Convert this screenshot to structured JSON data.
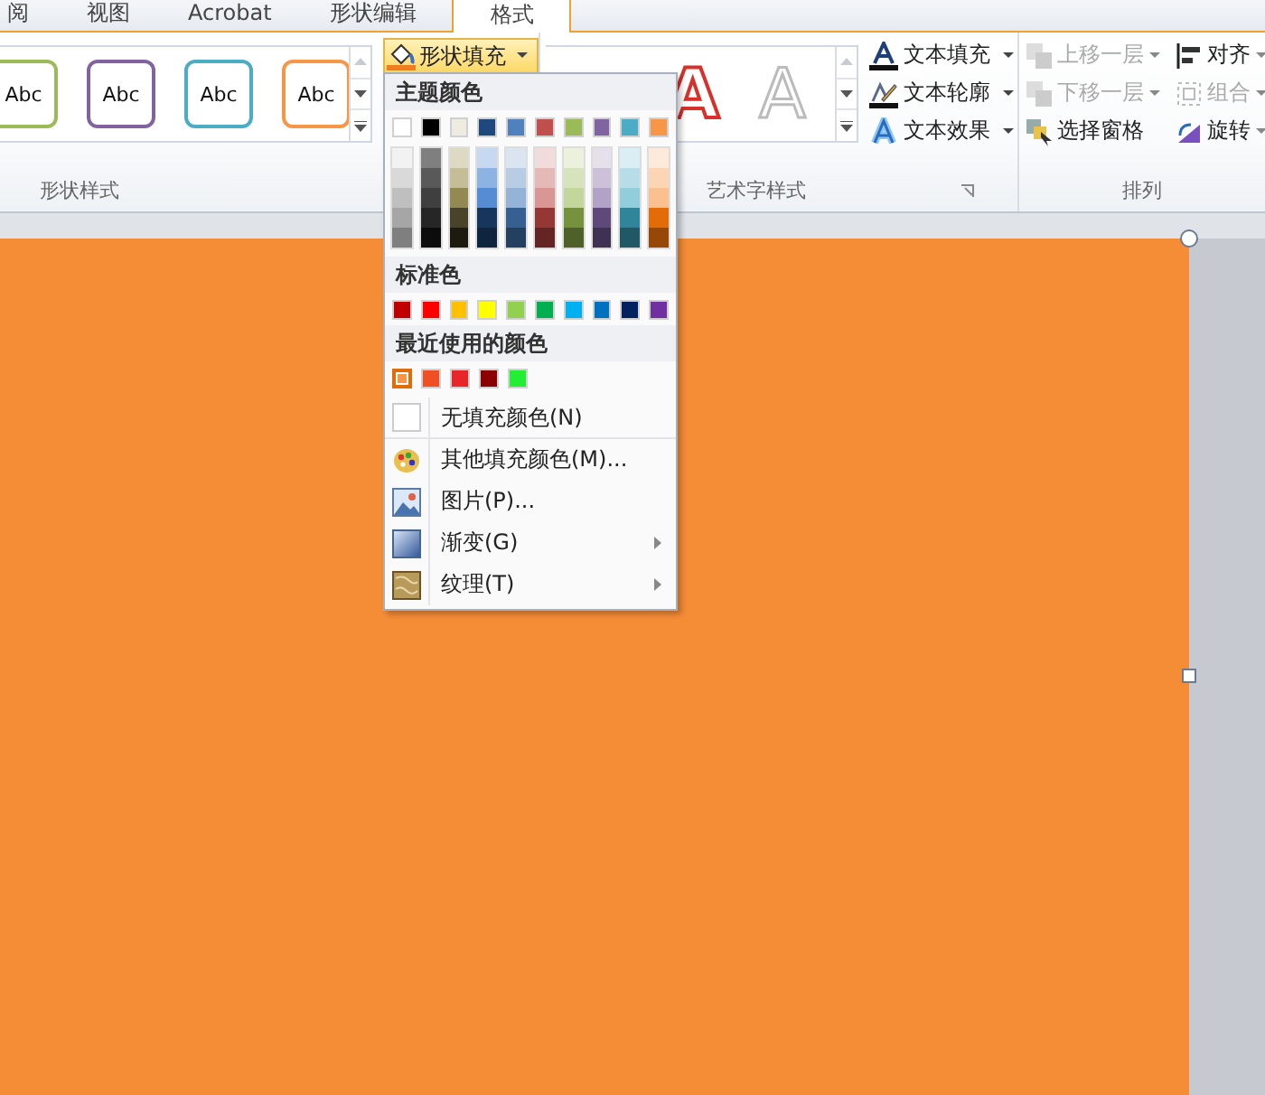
{
  "tabs": [
    {
      "label": "阅",
      "selected": false
    },
    {
      "label": "视图",
      "selected": false
    },
    {
      "label": "Acrobat",
      "selected": false
    },
    {
      "label": "形状编辑",
      "selected": false
    },
    {
      "label": "格式",
      "selected": true
    }
  ],
  "shape_styles": {
    "styles": [
      {
        "label": "Abc",
        "color": "#9bbb59"
      },
      {
        "label": "Abc",
        "color": "#8064a2"
      },
      {
        "label": "Abc",
        "color": "#4bacc6"
      },
      {
        "label": "Abc",
        "color": "#f79646"
      }
    ],
    "fill_button": {
      "label": "形状填充",
      "open": true
    },
    "group_label": "形状样式"
  },
  "wordart": {
    "styles": [
      {
        "label": "A",
        "kind": "red-outline"
      },
      {
        "label": "A",
        "kind": "white-outline"
      }
    ],
    "commands": [
      {
        "label": "文本填充",
        "kind": "text-fill"
      },
      {
        "label": "文本轮廓",
        "kind": "text-outline"
      },
      {
        "label": "文本效果",
        "kind": "text-effect"
      }
    ],
    "group_label": "艺术字样式"
  },
  "arrange": {
    "columns": [
      [
        {
          "label": "上移一层",
          "kind": "bring-forward",
          "disabled": true
        },
        {
          "label": "下移一层",
          "kind": "send-backward",
          "disabled": true
        },
        {
          "label": "选择窗格",
          "kind": "selection-pane",
          "disabled": false
        }
      ],
      [
        {
          "label": "对齐",
          "kind": "align",
          "disabled": false
        },
        {
          "label": "组合",
          "kind": "group",
          "disabled": true
        },
        {
          "label": "旋转",
          "kind": "rotate",
          "disabled": false
        }
      ]
    ],
    "group_label": "排列"
  },
  "fill_menu": {
    "theme_header": "主题颜色",
    "theme_colors": [
      {
        "color": "#ffffff",
        "shades": [
          {
            "color": "#f2f2f2"
          },
          {
            "color": "#d9d9d9"
          },
          {
            "color": "#bfbfbf"
          },
          {
            "color": "#a6a6a6"
          },
          {
            "color": "#7f7f7f"
          }
        ]
      },
      {
        "color": "#000000",
        "shades": [
          {
            "color": "#7f7f7f"
          },
          {
            "color": "#595959"
          },
          {
            "color": "#3f3f3f"
          },
          {
            "color": "#262626"
          },
          {
            "color": "#0c0c0c"
          }
        ]
      },
      {
        "color": "#eeece1",
        "shades": [
          {
            "color": "#ddd9c3"
          },
          {
            "color": "#c4bd97"
          },
          {
            "color": "#938953"
          },
          {
            "color": "#494429"
          },
          {
            "color": "#1d1b10"
          }
        ]
      },
      {
        "color": "#1f497d",
        "shades": [
          {
            "color": "#c6d9f0"
          },
          {
            "color": "#8db3e2"
          },
          {
            "color": "#548dd4"
          },
          {
            "color": "#17365d"
          },
          {
            "color": "#0f243e"
          }
        ]
      },
      {
        "color": "#4f81bd",
        "shades": [
          {
            "color": "#dbe5f1"
          },
          {
            "color": "#b8cce4"
          },
          {
            "color": "#95b3d7"
          },
          {
            "color": "#366092"
          },
          {
            "color": "#244061"
          }
        ]
      },
      {
        "color": "#c0504d",
        "shades": [
          {
            "color": "#f2dcdb"
          },
          {
            "color": "#e5b9b7"
          },
          {
            "color": "#d99694"
          },
          {
            "color": "#953734"
          },
          {
            "color": "#632423"
          }
        ]
      },
      {
        "color": "#9bbb59",
        "shades": [
          {
            "color": "#ebf1dd"
          },
          {
            "color": "#d7e3bc"
          },
          {
            "color": "#c3d69b"
          },
          {
            "color": "#76923c"
          },
          {
            "color": "#4f6128"
          }
        ]
      },
      {
        "color": "#8064a2",
        "shades": [
          {
            "color": "#e5e0ec"
          },
          {
            "color": "#ccc1d9"
          },
          {
            "color": "#b2a2c7"
          },
          {
            "color": "#5f497a"
          },
          {
            "color": "#3f3151"
          }
        ]
      },
      {
        "color": "#4bacc6",
        "shades": [
          {
            "color": "#dbeef3"
          },
          {
            "color": "#b7dde8"
          },
          {
            "color": "#92cddc"
          },
          {
            "color": "#31859b"
          },
          {
            "color": "#205867"
          }
        ]
      },
      {
        "color": "#f79646",
        "shades": [
          {
            "color": "#fdeada"
          },
          {
            "color": "#fbd5b5"
          },
          {
            "color": "#fac08f"
          },
          {
            "color": "#e36c09"
          },
          {
            "color": "#974806"
          }
        ]
      }
    ],
    "standard_header": "标准色",
    "standard_colors": [
      {
        "color": "#c00000"
      },
      {
        "color": "#ff0000"
      },
      {
        "color": "#ffc000"
      },
      {
        "color": "#ffff00"
      },
      {
        "color": "#92d050"
      },
      {
        "color": "#00b050"
      },
      {
        "color": "#00b0f0"
      },
      {
        "color": "#0070c0"
      },
      {
        "color": "#002060"
      },
      {
        "color": "#7030a0"
      }
    ],
    "recent_header": "最近使用的颜色",
    "recent_colors": [
      {
        "color": "#f79646",
        "selected": true
      },
      {
        "color": "#f04e23",
        "selected": false
      },
      {
        "color": "#e8262a",
        "selected": false
      },
      {
        "color": "#8b0000",
        "selected": false
      },
      {
        "color": "#22ee33",
        "selected": false
      }
    ],
    "items": [
      {
        "kind": "no-fill",
        "label": "无填充颜色(N)",
        "submenu": false
      },
      {
        "kind": "more-colors",
        "label": "其他填充颜色(M)...",
        "submenu": false
      },
      {
        "kind": "picture",
        "label": "图片(P)...",
        "submenu": false
      },
      {
        "kind": "gradient",
        "label": "渐变(G)",
        "submenu": true
      },
      {
        "kind": "texture",
        "label": "纹理(T)",
        "submenu": true
      }
    ]
  }
}
